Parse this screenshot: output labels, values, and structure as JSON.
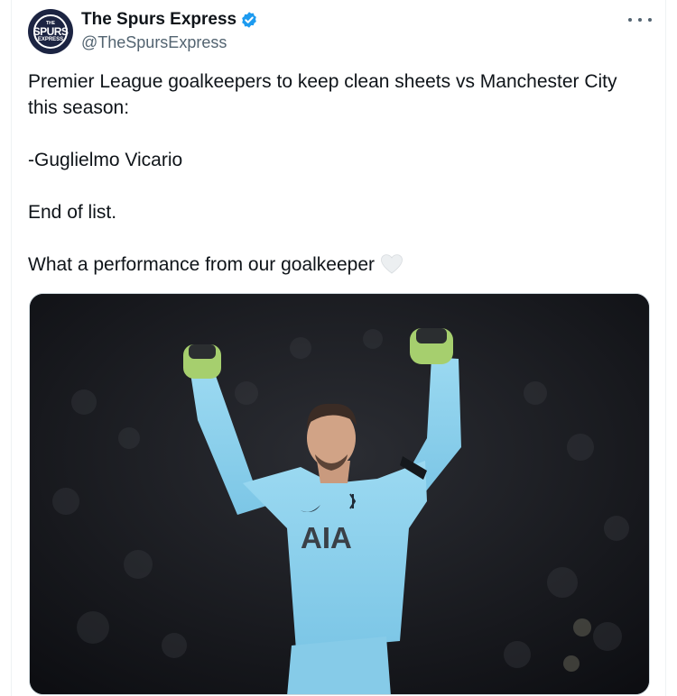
{
  "author": {
    "display_name": "The Spurs Express",
    "handle": "@TheSpursExpress",
    "avatar_text": [
      "THE",
      "SPURS",
      "EXPRESS"
    ],
    "verified": true
  },
  "tweet": {
    "paragraphs": [
      "Premier League goalkeepers to keep clean sheets vs Manchester City this season:",
      "-Guglielmo Vicario",
      "End of list.",
      "What a performance from our goalkeeper"
    ],
    "emoji": "white-heart"
  },
  "media": {
    "sponsor_text": "AIA",
    "jersey_color": "#8fd3ee",
    "glove_color": "#a6cf6e"
  },
  "colors": {
    "verified_blue": "#1d9bf0",
    "secondary_text": "#536471"
  }
}
